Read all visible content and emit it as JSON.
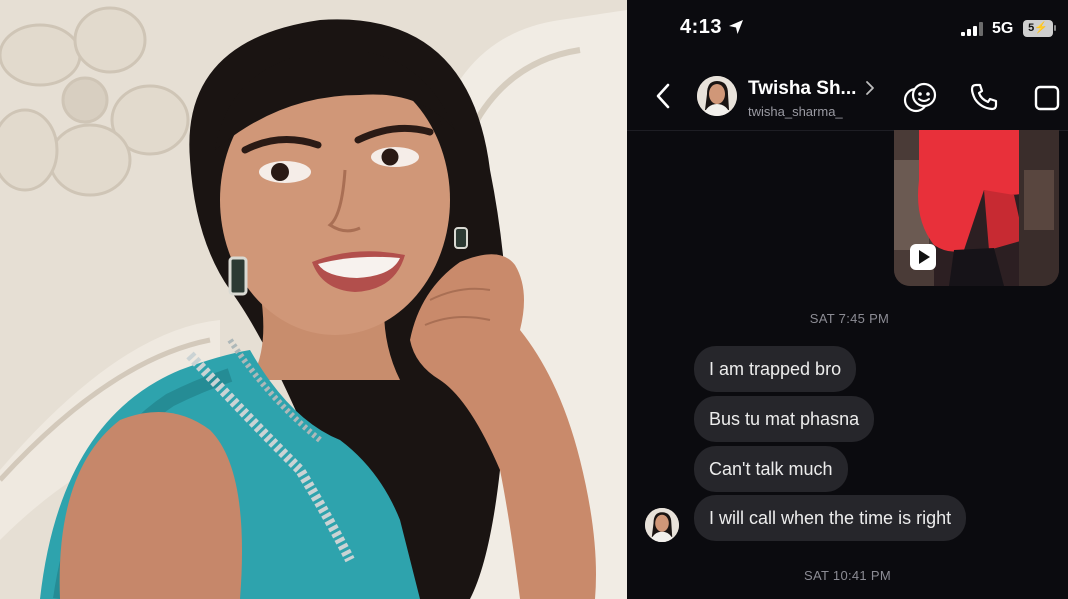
{
  "status_bar": {
    "time": "4:13",
    "network": "5G",
    "battery": "5",
    "icons": [
      "location-arrow-icon",
      "cellular-signal-icon",
      "battery-charging-icon"
    ]
  },
  "header": {
    "contact_name": "Twisha Sh...",
    "username": "twisha_sharma_",
    "icons": [
      "back-chevron-icon",
      "chevron-right-icon",
      "sticker-icon",
      "phone-icon",
      "video-icon"
    ]
  },
  "media": {
    "icon": "play-icon"
  },
  "messages": {
    "timestamp1": "SAT 7:45 PM",
    "bubbles": [
      "I am trapped bro",
      "Bus tu mat phasna",
      "Can't talk much",
      "I will call when the time is right"
    ],
    "timestamp2": "SAT 10:41 PM"
  },
  "colors": {
    "chat_background": "#0b0b0f",
    "bubble": "#26262b",
    "timestamp_text": "#8c8c94",
    "photo_top": "#2ea3ad"
  }
}
